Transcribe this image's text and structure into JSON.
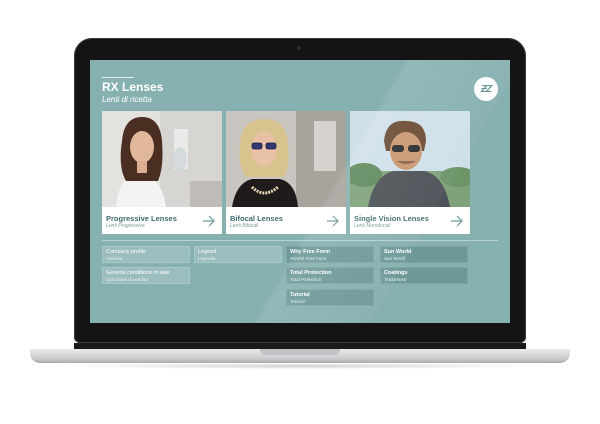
{
  "header": {
    "title": "RX Lenses",
    "subtitle": "Lenti di ricetta",
    "logo_icon": "brand-logo-icon"
  },
  "cards": [
    {
      "label": "Progressive Lenses",
      "sublabel": "Lenti Progressive"
    },
    {
      "label": "Bifocal Lenses",
      "sublabel": "Lenti Bifocali"
    },
    {
      "label": "Single Vision Lenses",
      "sublabel": "Lenti Monofocali"
    }
  ],
  "menu": {
    "company_profile": {
      "label": "Company profile",
      "sublabel": "Azienda"
    },
    "general_conditions": {
      "label": "General conditions of sale",
      "sublabel": "Condizioni di vendita"
    },
    "legend": {
      "label": "Legend",
      "sublabel": "Legenda"
    },
    "why_free_form": {
      "label": "Why Free Form",
      "sublabel": "Perché Free Form"
    },
    "total_protection": {
      "label": "Total Protection",
      "sublabel": "Total Protection"
    },
    "tutorial": {
      "label": "Tutorial",
      "sublabel": "Tutorial"
    },
    "sun_world": {
      "label": "Sun World",
      "sublabel": "Sun World"
    },
    "coatings": {
      "label": "Coatings",
      "sublabel": "Trattamenti"
    }
  },
  "colors": {
    "screen_bg": "#87b0b0",
    "accent": "#3e6c6d",
    "tile_light": "#9cbdbd",
    "tile_dark": "#6f9999"
  }
}
